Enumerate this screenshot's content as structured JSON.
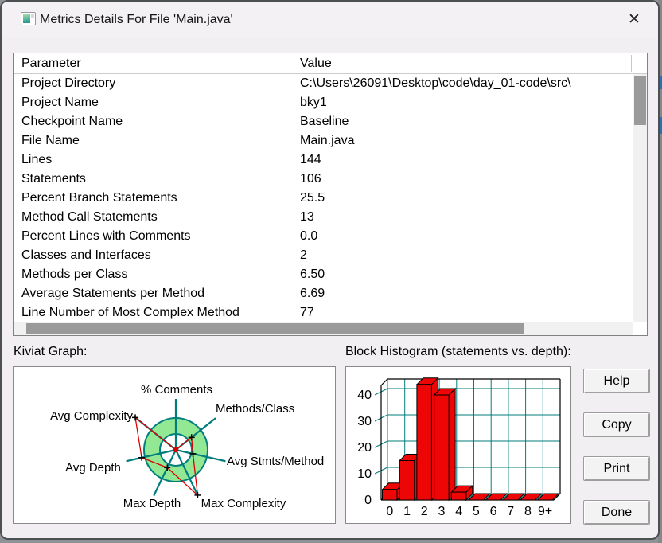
{
  "window": {
    "title": "Metrics Details For File 'Main.java'",
    "close_glyph": "✕"
  },
  "labels": {
    "kiviat": "Kiviat Graph:",
    "histogram": "Block Histogram (statements vs. depth):"
  },
  "table": {
    "columns": [
      "Parameter",
      "Value"
    ],
    "rows": [
      {
        "parameter": "Project Directory",
        "value": "C:\\Users\\26091\\Desktop\\code\\day_01-code\\src\\"
      },
      {
        "parameter": "Project Name",
        "value": "bky1"
      },
      {
        "parameter": "Checkpoint Name",
        "value": "Baseline"
      },
      {
        "parameter": "File Name",
        "value": "Main.java"
      },
      {
        "parameter": "Lines",
        "value": "144"
      },
      {
        "parameter": "Statements",
        "value": "106"
      },
      {
        "parameter": "Percent Branch Statements",
        "value": "25.5"
      },
      {
        "parameter": "Method Call Statements",
        "value": "13"
      },
      {
        "parameter": "Percent Lines with Comments",
        "value": "0.0"
      },
      {
        "parameter": "Classes and Interfaces",
        "value": "2"
      },
      {
        "parameter": "Methods per Class",
        "value": "6.50"
      },
      {
        "parameter": "Average Statements per Method",
        "value": "6.69"
      },
      {
        "parameter": "Line Number of Most Complex Method",
        "value": "77"
      }
    ]
  },
  "buttons": [
    {
      "label": "Help"
    },
    {
      "label": "Copy"
    },
    {
      "label": "Print"
    },
    {
      "label": "Done"
    }
  ],
  "colors": {
    "teal": "#007d7d",
    "kiviat_green": "#93e893",
    "bar_red": "#ee0505",
    "series_red": "#dd0000",
    "scrollbar_thumb": "#9a9a9a"
  },
  "chart_data": [
    {
      "type": "radar",
      "title": "Kiviat Graph",
      "axes": [
        "% Comments",
        "Methods/Class",
        "Avg Stmts/Method",
        "Max Complexity",
        "Max Depth",
        "Avg Depth",
        "Avg Complexity"
      ],
      "values_ring_relative": [
        0.0,
        0.63,
        0.55,
        1.58,
        0.62,
        1.1,
        1.63
      ],
      "ring_inner": 0.5,
      "ring_outer": 1.0,
      "axis_length": 1.6,
      "legend": "none",
      "colors": {
        "ring_fill": "#93e893",
        "axis": "#007d7d",
        "series": "#dd0000",
        "marker": "#000000"
      }
    },
    {
      "type": "bar",
      "title": "Block Histogram (statements vs. depth)",
      "xlabel": "depth",
      "ylabel": "statements",
      "categories": [
        "0",
        "1",
        "2",
        "3",
        "4",
        "5",
        "6",
        "7",
        "8",
        "9+"
      ],
      "values": [
        4,
        15,
        44,
        40,
        3,
        0,
        0,
        0,
        0,
        0
      ],
      "yticks": [
        0,
        10,
        20,
        30,
        40
      ],
      "ylim": [
        0,
        46
      ],
      "grid": true,
      "style": "3d",
      "bar_color": "#ee0505",
      "grid_color": "#007d7d"
    }
  ]
}
